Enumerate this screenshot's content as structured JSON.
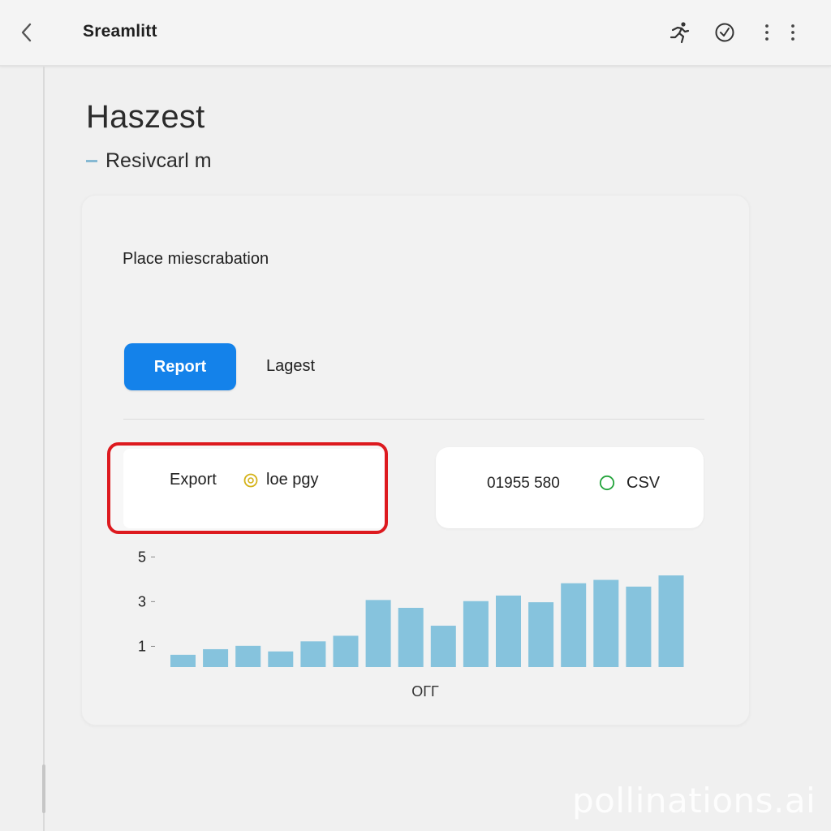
{
  "header": {
    "app_title": "Sreamlitt"
  },
  "page": {
    "title": "Haszest",
    "subheader": "Resivcarl m",
    "description": "Place miescrabation"
  },
  "tabs": {
    "primary_label": "Report",
    "secondary_label": "Lagest"
  },
  "export_panel": {
    "label": "Export",
    "option_label": "loe pgy",
    "indicator_color": "#d4b21a",
    "highlight_color": "#dd1a1f"
  },
  "info_panel": {
    "value": "01955 580",
    "option_label": "CSV",
    "indicator_color": "#22a33a"
  },
  "colors": {
    "accent": "#1482ea",
    "bar": "#86c3dd"
  },
  "watermark": "pollinations.ai",
  "chart_data": {
    "type": "bar",
    "title": "",
    "xlabel": "OГГ",
    "ylabel": "",
    "yticks": [
      "5",
      "3",
      "1"
    ],
    "ylim": [
      0,
      5.3
    ],
    "grid": false,
    "categories": [
      "",
      "",
      "",
      "",
      "",
      "",
      "",
      "",
      "",
      "",
      "",
      "",
      "",
      "",
      "",
      ""
    ],
    "values": [
      0.55,
      0.8,
      0.95,
      0.7,
      1.15,
      1.4,
      3.0,
      2.65,
      1.85,
      2.95,
      3.2,
      2.9,
      3.75,
      3.9,
      3.6,
      4.1
    ]
  }
}
